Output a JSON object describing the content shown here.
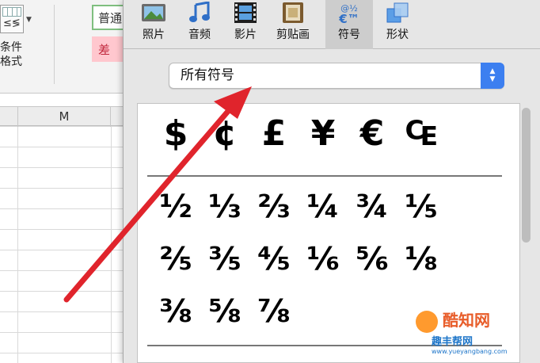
{
  "excel": {
    "ribbon": {
      "conditional_format_label": "条件\n格式",
      "style_normal": "普通",
      "style_bad": "差"
    },
    "column_header": "M"
  },
  "panel": {
    "tabs": [
      {
        "label": "照片",
        "icon": "photo-icon"
      },
      {
        "label": "音频",
        "icon": "music-note-icon"
      },
      {
        "label": "影片",
        "icon": "film-icon"
      },
      {
        "label": "剪贴画",
        "icon": "clipart-icon"
      },
      {
        "label": "符号",
        "icon": "symbols-icon",
        "active": true
      },
      {
        "label": "形状",
        "icon": "shapes-icon"
      }
    ],
    "symbols_tab_glyph": "€™",
    "dropdown": {
      "value": "所有符号",
      "stepper": "⌃⌄"
    },
    "symbol_rows": [
      [
        "$",
        "¢",
        "£",
        "¥",
        "€",
        "₠"
      ],
      [
        "½",
        "⅓",
        "⅔",
        "¼",
        "¾",
        "⅕"
      ],
      [
        "⅖",
        "⅗",
        "⅘",
        "⅙",
        "⅚",
        "⅛"
      ],
      [
        "⅜",
        "⅝",
        "⅞"
      ]
    ]
  },
  "watermark": {
    "brand": "酷知网",
    "brand2": "趣丰帮网",
    "site": "www.yueyangbang.com"
  },
  "colors": {
    "arrow": "#e0242c",
    "stepper": "#3c7ff0",
    "bad_bg": "#ffc7ce",
    "bad_text": "#c0263b"
  }
}
